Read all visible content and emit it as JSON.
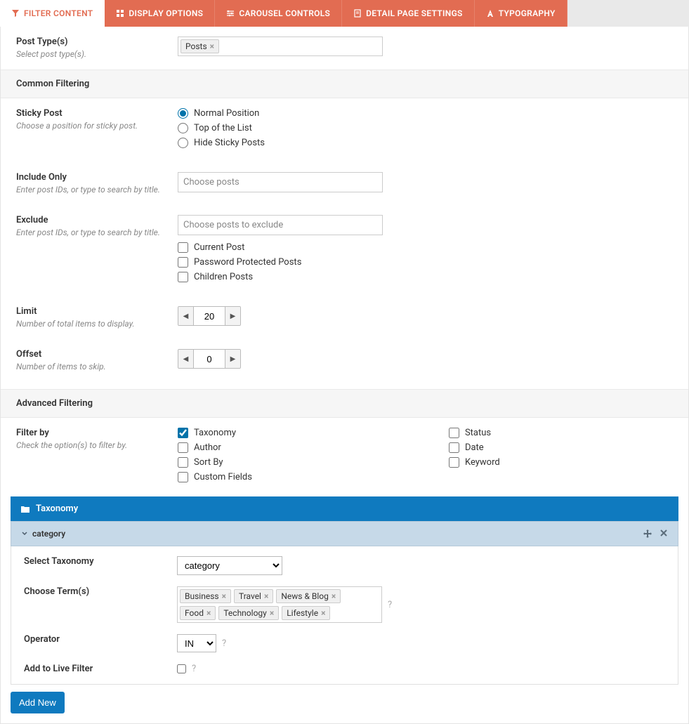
{
  "tabs": [
    {
      "label": "FILTER CONTENT",
      "active": true
    },
    {
      "label": "DISPLAY OPTIONS",
      "active": false
    },
    {
      "label": "CAROUSEL CONTROLS",
      "active": false
    },
    {
      "label": "DETAIL PAGE SETTINGS",
      "active": false
    },
    {
      "label": "TYPOGRAPHY",
      "active": false
    }
  ],
  "postType": {
    "label": "Post Type(s)",
    "desc": "Select post type(s).",
    "tags": [
      "Posts"
    ]
  },
  "sections": {
    "common": "Common Filtering",
    "advanced": "Advanced Filtering"
  },
  "sticky": {
    "label": "Sticky Post",
    "desc": "Choose a position for sticky post.",
    "options": [
      "Normal Position",
      "Top of the List",
      "Hide Sticky Posts"
    ],
    "selected": "Normal Position"
  },
  "includeOnly": {
    "label": "Include Only",
    "desc": "Enter post IDs, or type to search by title.",
    "placeholder": "Choose posts"
  },
  "exclude": {
    "label": "Exclude",
    "desc": "Enter post IDs, or type to search by title.",
    "placeholder": "Choose posts to exclude",
    "checks": [
      "Current Post",
      "Password Protected Posts",
      "Children Posts"
    ]
  },
  "limit": {
    "label": "Limit",
    "desc": "Number of total items to display.",
    "value": "20"
  },
  "offset": {
    "label": "Offset",
    "desc": "Number of items to skip.",
    "value": "0"
  },
  "filterBy": {
    "label": "Filter by",
    "desc": "Check the option(s) to filter by.",
    "col1": [
      {
        "label": "Taxonomy",
        "checked": true
      },
      {
        "label": "Author",
        "checked": false
      },
      {
        "label": "Sort By",
        "checked": false
      },
      {
        "label": "Custom Fields",
        "checked": false
      }
    ],
    "col2": [
      {
        "label": "Status",
        "checked": false
      },
      {
        "label": "Date",
        "checked": false
      },
      {
        "label": "Keyword",
        "checked": false
      }
    ]
  },
  "tax": {
    "heading": "Taxonomy",
    "cat": {
      "title": "category",
      "selectTaxonomy": {
        "label": "Select Taxonomy",
        "value": "category"
      },
      "chooseTerms": {
        "label": "Choose Term(s)",
        "tags": [
          "Business",
          "Travel",
          "News & Blog",
          "Food",
          "Technology",
          "Lifestyle"
        ]
      },
      "operator": {
        "label": "Operator",
        "value": "IN"
      },
      "liveFilter": {
        "label": "Add to Live Filter"
      }
    },
    "addNew": "Add New"
  }
}
